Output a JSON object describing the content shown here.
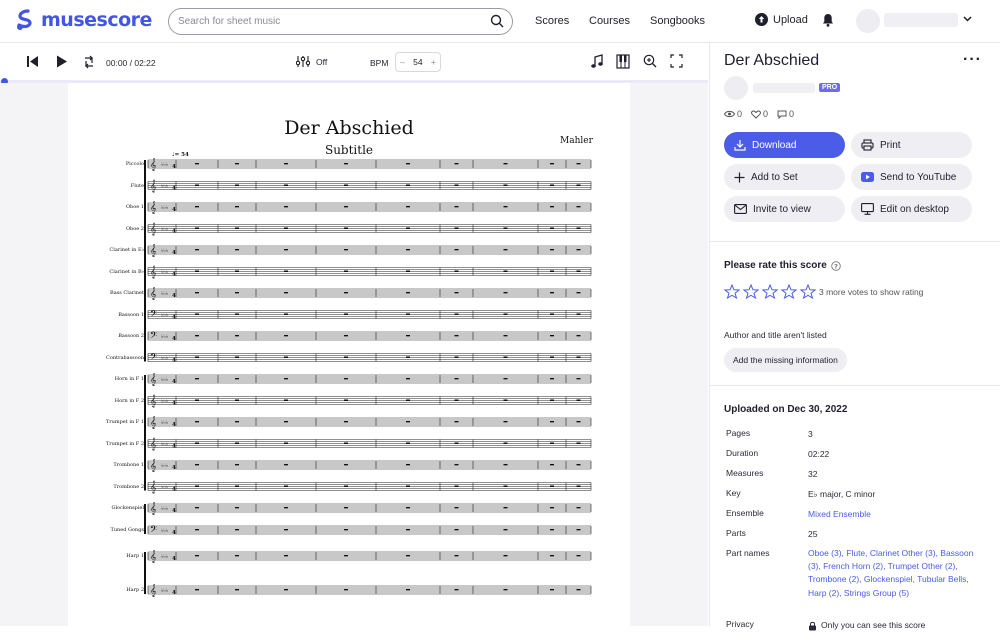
{
  "brand": {
    "name": "musescore",
    "accent": "#4356e3"
  },
  "nav": {
    "search_placeholder": "Search for sheet music",
    "links": [
      "Scores",
      "Courses",
      "Songbooks"
    ],
    "upload": "Upload"
  },
  "player": {
    "time": "00:00 / 02:22",
    "mixer": "Off",
    "bpm_label": "BPM",
    "bpm_minus": "–",
    "bpm_value": "54",
    "bpm_plus": "+"
  },
  "score": {
    "title": "Der Abschied",
    "subtitle": "Subtitle",
    "composer": "Mahler",
    "tempo": "♩= 54",
    "instruments": [
      "Piccolo",
      "Flute",
      "Oboe 1",
      "Oboe 2",
      "Clarinet in E♭",
      "Clarinet in B♭",
      "Bass Clarinet",
      "Bassoon 1",
      "Bassoon 2",
      "Contrabassoon",
      "Horn in F 1",
      "Horn in F 2",
      "Trumpet in F 1",
      "Trumpet in F 2",
      "Trombone 1",
      "Trombone 2",
      "Glockenspiel",
      "Tuned Gongs",
      "Harp 1",
      "Harp 2"
    ]
  },
  "panel": {
    "title": "Der Abschied",
    "pro_badge": "PRO",
    "views": "0",
    "favorites": "0",
    "comments": "0",
    "buttons": {
      "download": "Download",
      "print": "Print",
      "add_to_set": "Add to Set",
      "send_to_youtube": "Send to YouTube",
      "invite": "Invite to view",
      "edit_desktop": "Edit on desktop"
    },
    "rate_title": "Please rate this score",
    "votes_note": "3 more votes to show rating",
    "author_note": "Author and title aren't listed",
    "add_info": "Add the missing information",
    "uploaded": "Uploaded on Dec 30, 2022",
    "meta": [
      {
        "label": "Pages",
        "value": "3"
      },
      {
        "label": "Duration",
        "value": "02:22"
      },
      {
        "label": "Measures",
        "value": "32"
      },
      {
        "label": "Key",
        "value": "E♭ major, C minor"
      },
      {
        "label": "Ensemble",
        "value": "Mixed Ensemble"
      },
      {
        "label": "Parts",
        "value": "25"
      },
      {
        "label": "Part names",
        "value": "Oboe (3), Flute, Clarinet Other (3), Bassoon (3), French Horn (2), Trumpet Other (2), Trombone (2), Glockenspiel, Tubular Bells, Harp (2), Strings Group (5)"
      }
    ],
    "privacy_label": "Privacy",
    "privacy_value": "Only you can see this score"
  }
}
